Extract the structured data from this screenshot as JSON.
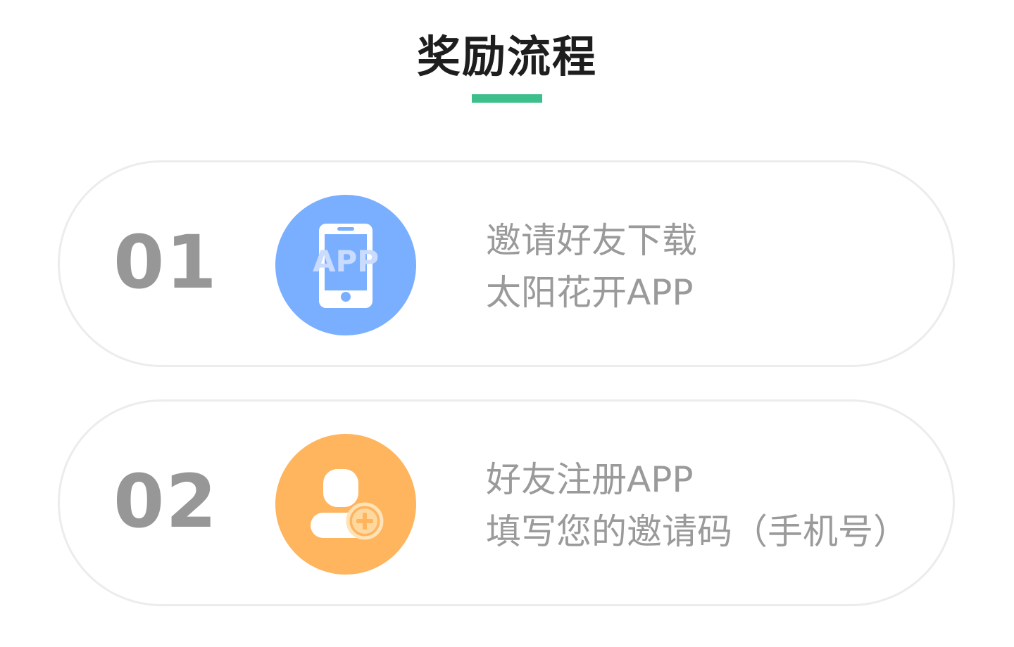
{
  "header": {
    "title": "奖励流程"
  },
  "colors": {
    "accent": "#3cbf8a",
    "step1_circle": "#7aafff",
    "step2_circle": "#ffb45e",
    "number_gray": "#979797",
    "text_gray": "#9a9a9a"
  },
  "steps": [
    {
      "number": "01",
      "icon": "phone-app-icon",
      "icon_label": "APP",
      "lines": [
        "邀请好友下载",
        "太阳花开APP"
      ]
    },
    {
      "number": "02",
      "icon": "add-user-icon",
      "lines": [
        "好友注册APP",
        "填写您的邀请码（手机号）"
      ]
    }
  ]
}
